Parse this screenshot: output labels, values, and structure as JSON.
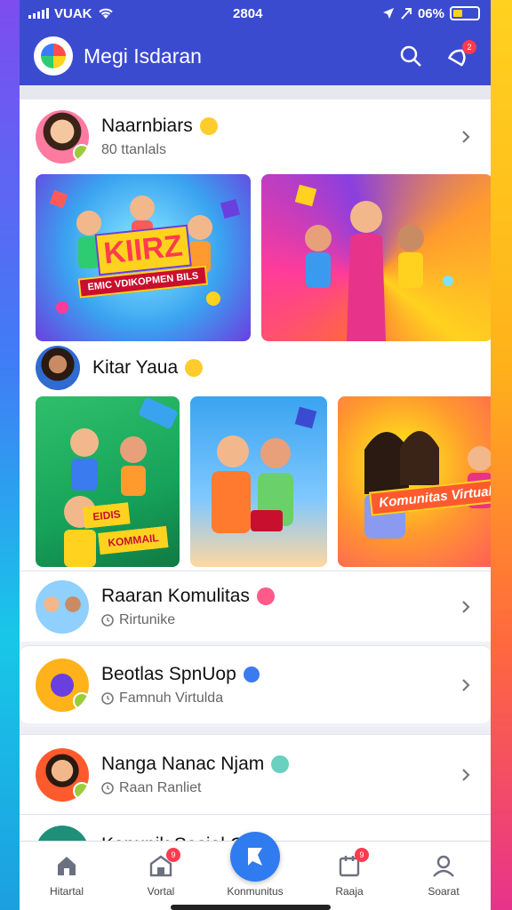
{
  "status": {
    "carrier": "VUAK",
    "time": "2804",
    "battery": "06%"
  },
  "app": {
    "title": "Megi Isdaran",
    "notification_count": "2"
  },
  "feed": {
    "group1": {
      "name": "Naarnbiars",
      "sub": "80 ttanlals"
    },
    "group2": {
      "name": "Kitar Yaua"
    },
    "tiles": {
      "t1_label": "KIIRZ",
      "t1_banner": "EMIC VDIKOPMEN BILS",
      "t2_label": "",
      "t3_banner1": "EIDIS",
      "t3_banner2": "KOMMAIL",
      "t5_banner": "Komunitas Virtual"
    }
  },
  "list": [
    {
      "title": "Raaran Komulitas",
      "sub": "Rirtunike"
    },
    {
      "title": "Beotlas SpnUop",
      "sub": "Famnuh Virtulda"
    },
    {
      "title": "Nanga Nanac Njam",
      "sub": "Raan Ranliet"
    },
    {
      "title": "Kanunik Sosial C"
    }
  ],
  "nav": [
    {
      "label": "Hitartal"
    },
    {
      "label": "Vortal",
      "badge": "9"
    },
    {
      "label": "Konmunitus"
    },
    {
      "label": "Raaja",
      "badge": "9"
    },
    {
      "label": "Soarat"
    }
  ],
  "colors": {
    "primary": "#3b4bd0",
    "fab": "#2f7bf0",
    "badge": "#ff3b4e"
  }
}
